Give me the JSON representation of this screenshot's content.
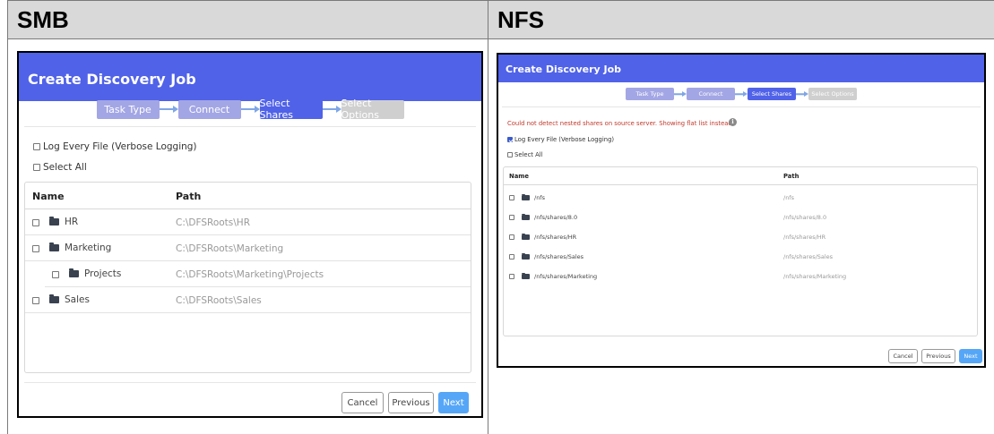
{
  "columns": {
    "smb_header": "SMB",
    "nfs_header": "NFS"
  },
  "smb": {
    "title": "Create Discovery Job",
    "steps": [
      "Task Type",
      "Connect",
      "Select Shares",
      "Select Options"
    ],
    "log_label": "Log Every File (Verbose Logging)",
    "select_all_label": "Select All",
    "col_name": "Name",
    "col_path": "Path",
    "rows": [
      {
        "name": "HR",
        "path": "C:\\DFSRoots\\HR"
      },
      {
        "name": "Marketing",
        "path": "C:\\DFSRoots\\Marketing"
      },
      {
        "name": "Projects",
        "path": "C:\\DFSRoots\\Marketing\\Projects"
      },
      {
        "name": "Sales",
        "path": "C:\\DFSRoots\\Sales"
      }
    ],
    "buttons": {
      "cancel": "Cancel",
      "previous": "Previous",
      "next": "Next"
    }
  },
  "nfs": {
    "title": "Create Discovery Job",
    "steps": [
      "Task Type",
      "Connect",
      "Select Shares",
      "Select Options"
    ],
    "error_message": "Could not detect nested shares on source server. Showing flat list instead.",
    "info_icon_text": "i",
    "log_label": "Log Every File (Verbose Logging)",
    "log_checked": true,
    "select_all_label": "Select All",
    "col_name": "Name",
    "col_path": "Path",
    "rows": [
      {
        "name": "/nfs",
        "path": "/nfs"
      },
      {
        "name": "/nfs/shares/8.0",
        "path": "/nfs/shares/8.0"
      },
      {
        "name": "/nfs/shares/HR",
        "path": "/nfs/shares/HR"
      },
      {
        "name": "/nfs/shares/Sales",
        "path": "/nfs/shares/Sales"
      },
      {
        "name": "/nfs/shares/Marketing",
        "path": "/nfs/shares/Marketing"
      }
    ],
    "buttons": {
      "cancel": "Cancel",
      "previous": "Previous",
      "next": "Next"
    }
  },
  "colors": {
    "title_bar": "#5062e8",
    "step_done": "#a3a6e4",
    "step_active": "#5062e8",
    "step_todo": "#cfcfcf",
    "error_text": "#c0392b",
    "primary_button": "#56a6f7"
  },
  "icons": [
    "folder-icon",
    "checkbox-icon",
    "info-icon",
    "arrow-right-icon"
  ]
}
